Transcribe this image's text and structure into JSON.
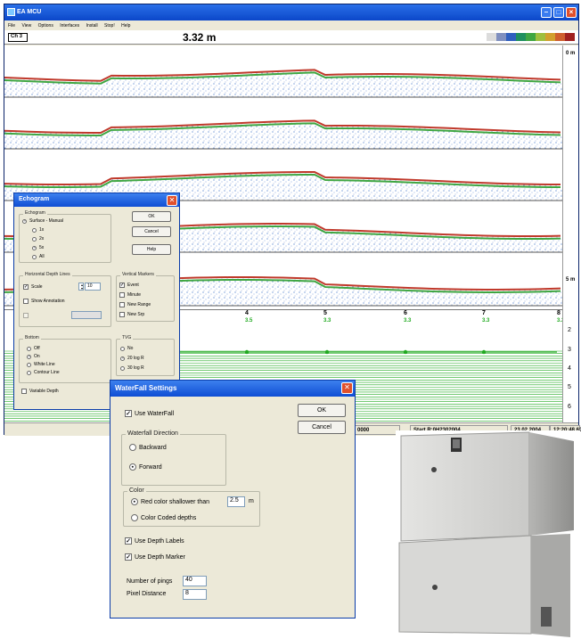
{
  "window": {
    "title": "EA MCU"
  },
  "menu": [
    "File",
    "View",
    "Options",
    "Interfaces",
    "Install",
    "Stop!",
    "Help"
  ],
  "status_top": {
    "channel": "Ch 3",
    "depth_reading": "3.32 m"
  },
  "echo_ruler": {
    "top_label": "0 m",
    "bottom_label": "5 m"
  },
  "trend": {
    "markers": [
      {
        "num": "1",
        "depth": ""
      },
      {
        "num": "4",
        "depth": "3.5"
      },
      {
        "num": "5",
        "depth": "3.3"
      },
      {
        "num": "6",
        "depth": "3.3"
      },
      {
        "num": "7",
        "depth": "3.3"
      },
      {
        "num": "8",
        "depth": "3.3"
      }
    ],
    "ruler_labels": [
      "2",
      "3",
      "4",
      "5",
      "6"
    ]
  },
  "statusbar": {
    "code": "0000",
    "start_label": "Start",
    "file": "R:0H2302004",
    "date": "23.02.2004",
    "time": "12:20:48.63"
  },
  "echogram_dialog": {
    "title": "Echogram",
    "close": "✕",
    "echogram_group": "Echogram",
    "surface_manual": "Surface - Manual",
    "zoom_options": [
      "1x",
      "2x",
      "5x",
      "All"
    ],
    "selected_zoom": "5x",
    "ok": "OK",
    "cancel": "Cancel",
    "help": "Help",
    "hdl_group": "Horizontal Depth Lines",
    "scale": "Scale",
    "scale_value": "10",
    "show_annotation": "Show Annotation",
    "vm_group": "Vertical Markers",
    "vm_items": [
      "Event",
      "Minute",
      "New Range",
      "New Srp"
    ],
    "bottom_group": "Bottom",
    "bottom_options": [
      "Off",
      "On",
      "White Line",
      "Contour Line"
    ],
    "selected_bottom": "On",
    "tvg_group": "TVG",
    "tvg_options": [
      "No",
      "20 log R",
      "30 log R"
    ],
    "selected_tvg": "20 log R",
    "variable_depth": "Variable Depth"
  },
  "waterfall_dialog": {
    "title": "WaterFall Settings",
    "close": "✕",
    "use_waterfall": "Use WaterFall",
    "ok": "OK",
    "cancel": "Cancel",
    "direction_group": "Waterfall Direction",
    "direction_options": [
      "Backward",
      "Forward"
    ],
    "selected_direction": "Forward",
    "color_group": "Color",
    "red_color_label": "Red color shallower than",
    "red_color_value": "2.5",
    "red_color_unit": "m",
    "color_coded": "Color Coded depths",
    "use_depth_labels": "Use Depth Labels",
    "use_depth_marker": "Use Depth Marker",
    "pings_label": "Number of pings",
    "pings_value": "40",
    "pixel_label": "Pixel Distance",
    "pixel_value": "8"
  },
  "colors": {
    "titlebar": "#0b47c9",
    "echo_blue": "#1f5fbf",
    "echo_green": "#3fa642",
    "echo_red": "#c0392b",
    "trend_line": "#22aa22",
    "trend_marker": "#22aa22"
  },
  "icons": {
    "app": "app-icon",
    "minimize": "minimize-icon",
    "maximize": "maximize-icon",
    "close": "close-icon"
  }
}
